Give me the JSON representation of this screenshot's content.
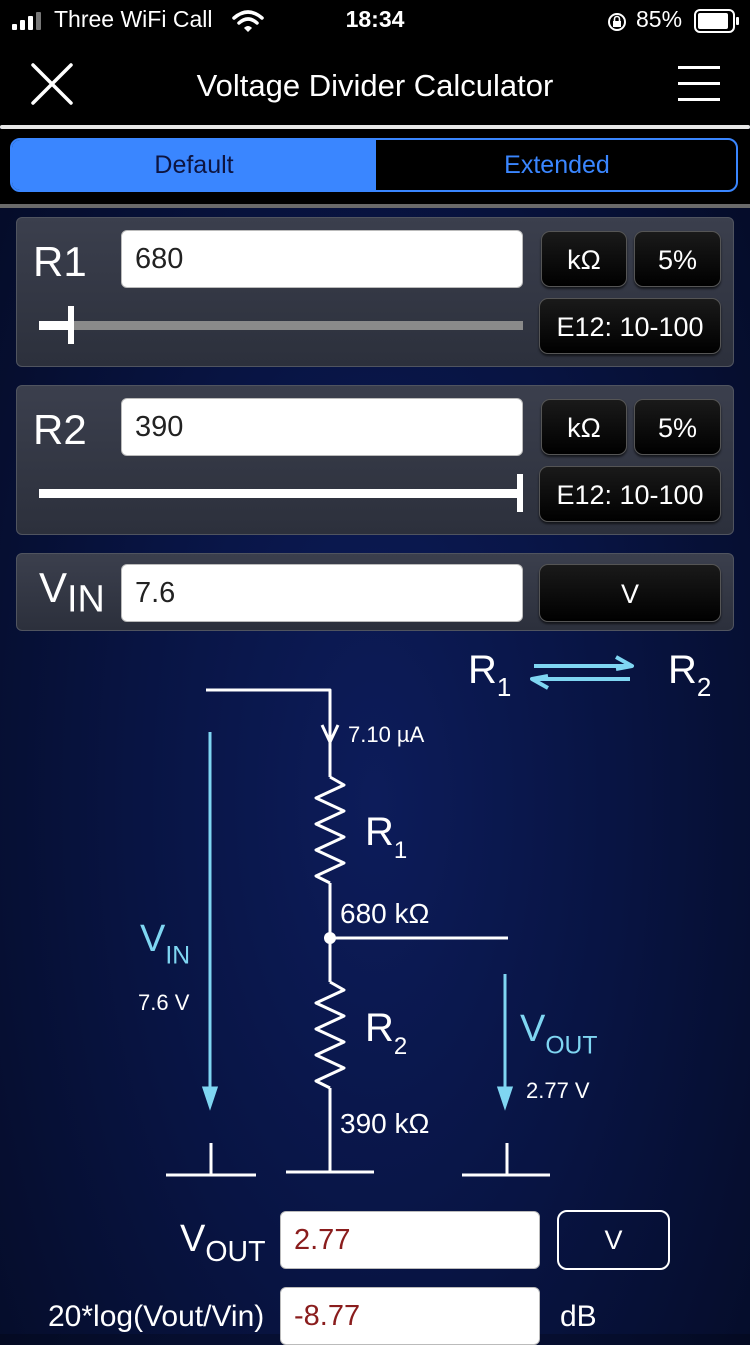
{
  "status_bar": {
    "carrier": "Three WiFi Call",
    "time": "18:34",
    "battery": "85%"
  },
  "header": {
    "title": "Voltage Divider Calculator"
  },
  "tabs": [
    {
      "label": "Default",
      "selected": true
    },
    {
      "label": "Extended",
      "selected": false
    }
  ],
  "r1": {
    "label": "R1",
    "value": "680",
    "unit": "kΩ",
    "tolerance": "5%",
    "series": "E12: 10-100",
    "slider_level": 0.06
  },
  "r2": {
    "label": "R2",
    "value": "390",
    "unit": "kΩ",
    "tolerance": "5%",
    "series": "E12: 10-100",
    "slider_level": 1.0
  },
  "vin": {
    "label_main": "V",
    "label_sub": "IN",
    "value": "7.6",
    "unit": "V"
  },
  "circuit": {
    "swap_left_main": "R",
    "swap_left_sub": "1",
    "swap_right_main": "R",
    "swap_right_sub": "2",
    "current": "7.10 µA",
    "r1_main": "R",
    "r1_sub": "1",
    "r1_value": "680 kΩ",
    "r2_main": "R",
    "r2_sub": "2",
    "r2_value": "390 kΩ",
    "vin_main": "V",
    "vin_sub": "IN",
    "vin_value": "7.6 V",
    "vout_main": "V",
    "vout_sub": "OUT",
    "vout_value": "2.77 V"
  },
  "output": {
    "vout_label_main": "V",
    "vout_label_sub": "OUT",
    "vout_value": "2.77",
    "vout_unit": "V",
    "db_label": "20*log(Vout/Vin)",
    "db_value": "-8.77",
    "db_unit": "dB"
  },
  "colors": {
    "accent": "#3a86ff",
    "circuit_arrow": "#7fd6f2",
    "output_text": "#8a1d1d"
  }
}
